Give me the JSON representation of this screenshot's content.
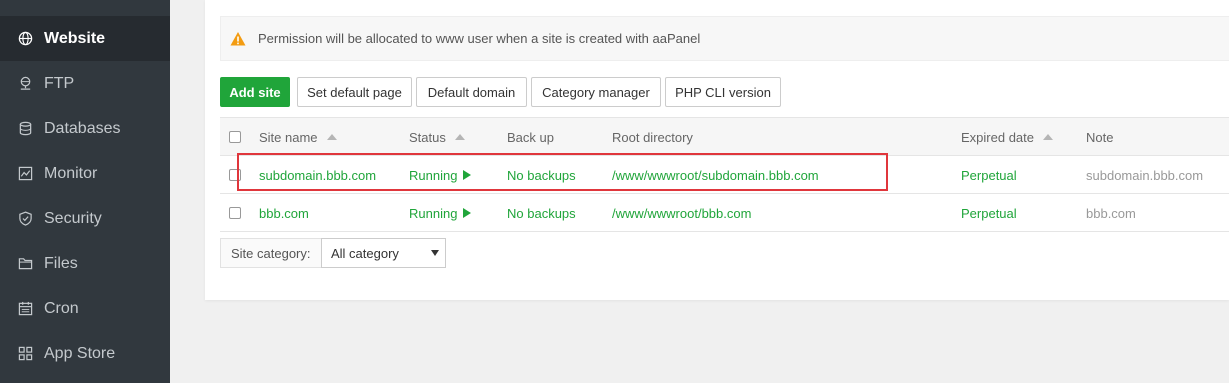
{
  "sidebar": {
    "items": [
      {
        "label": "Website",
        "icon": "globe-icon",
        "active": true
      },
      {
        "label": "FTP",
        "icon": "ftp-icon"
      },
      {
        "label": "Databases",
        "icon": "database-icon"
      },
      {
        "label": "Monitor",
        "icon": "monitor-icon"
      },
      {
        "label": "Security",
        "icon": "shield-icon"
      },
      {
        "label": "Files",
        "icon": "folder-icon"
      },
      {
        "label": "Cron",
        "icon": "calendar-icon"
      },
      {
        "label": "App Store",
        "icon": "grid-icon"
      }
    ]
  },
  "notice": {
    "text": "Permission will be allocated to www user when a site is created with aaPanel",
    "icon": "warning-icon"
  },
  "toolbar": {
    "add_site": "Add site",
    "set_default_page": "Set default page",
    "default_domain": "Default domain",
    "category_manager": "Category manager",
    "php_cli_version": "PHP CLI version"
  },
  "table": {
    "headers": {
      "site_name": "Site name",
      "status": "Status",
      "backup": "Back up",
      "root_directory": "Root directory",
      "expired_date": "Expired date",
      "note": "Note"
    },
    "rows": [
      {
        "site_name": "subdomain.bbb.com",
        "status": "Running",
        "backup": "No backups",
        "root_directory": "/www/wwwroot/subdomain.bbb.com",
        "expired_date": "Perpetual",
        "note": "subdomain.bbb.com"
      },
      {
        "site_name": "bbb.com",
        "status": "Running",
        "backup": "No backups",
        "root_directory": "/www/wwwroot/bbb.com",
        "expired_date": "Perpetual",
        "note": "bbb.com"
      }
    ]
  },
  "category": {
    "label": "Site category:",
    "selected": "All category"
  },
  "colors": {
    "sidebar_bg": "#31383e",
    "accent_green": "#20a53a",
    "warning_orange": "#f39c12",
    "highlight_red": "#e0363c"
  }
}
